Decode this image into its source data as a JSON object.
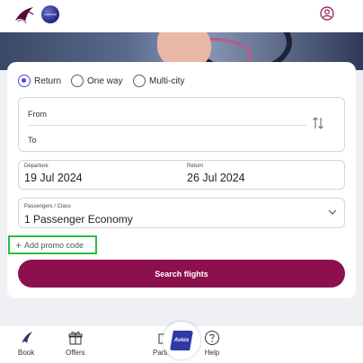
{
  "header": {
    "alliance_logo_text": "oneworld",
    "profile_icon": "user-circle-icon"
  },
  "trip_types": [
    {
      "label": "Return",
      "selected": true
    },
    {
      "label": "One way",
      "selected": false
    },
    {
      "label": "Multi-city",
      "selected": false
    }
  ],
  "fields": {
    "from_label": "From",
    "to_label": "To",
    "departure_caption": "Departure",
    "departure_value": "19 Jul 2024",
    "return_caption": "Return",
    "return_value": "26 Jul 2024",
    "passengers_caption": "Passengers / Class",
    "passengers_value": "1  Passenger Economy"
  },
  "promo": {
    "label": "Add promo code"
  },
  "search_button": {
    "label": "Search flights"
  },
  "bottom_nav": {
    "book": "Book",
    "offers": "Offers",
    "partners": "Partn",
    "help": "Help",
    "avios_badge": "Avios"
  },
  "colors": {
    "accent": "#8c0f4e",
    "radio_selected": "#4a4ad6",
    "highlight": "#2bbf3e"
  }
}
